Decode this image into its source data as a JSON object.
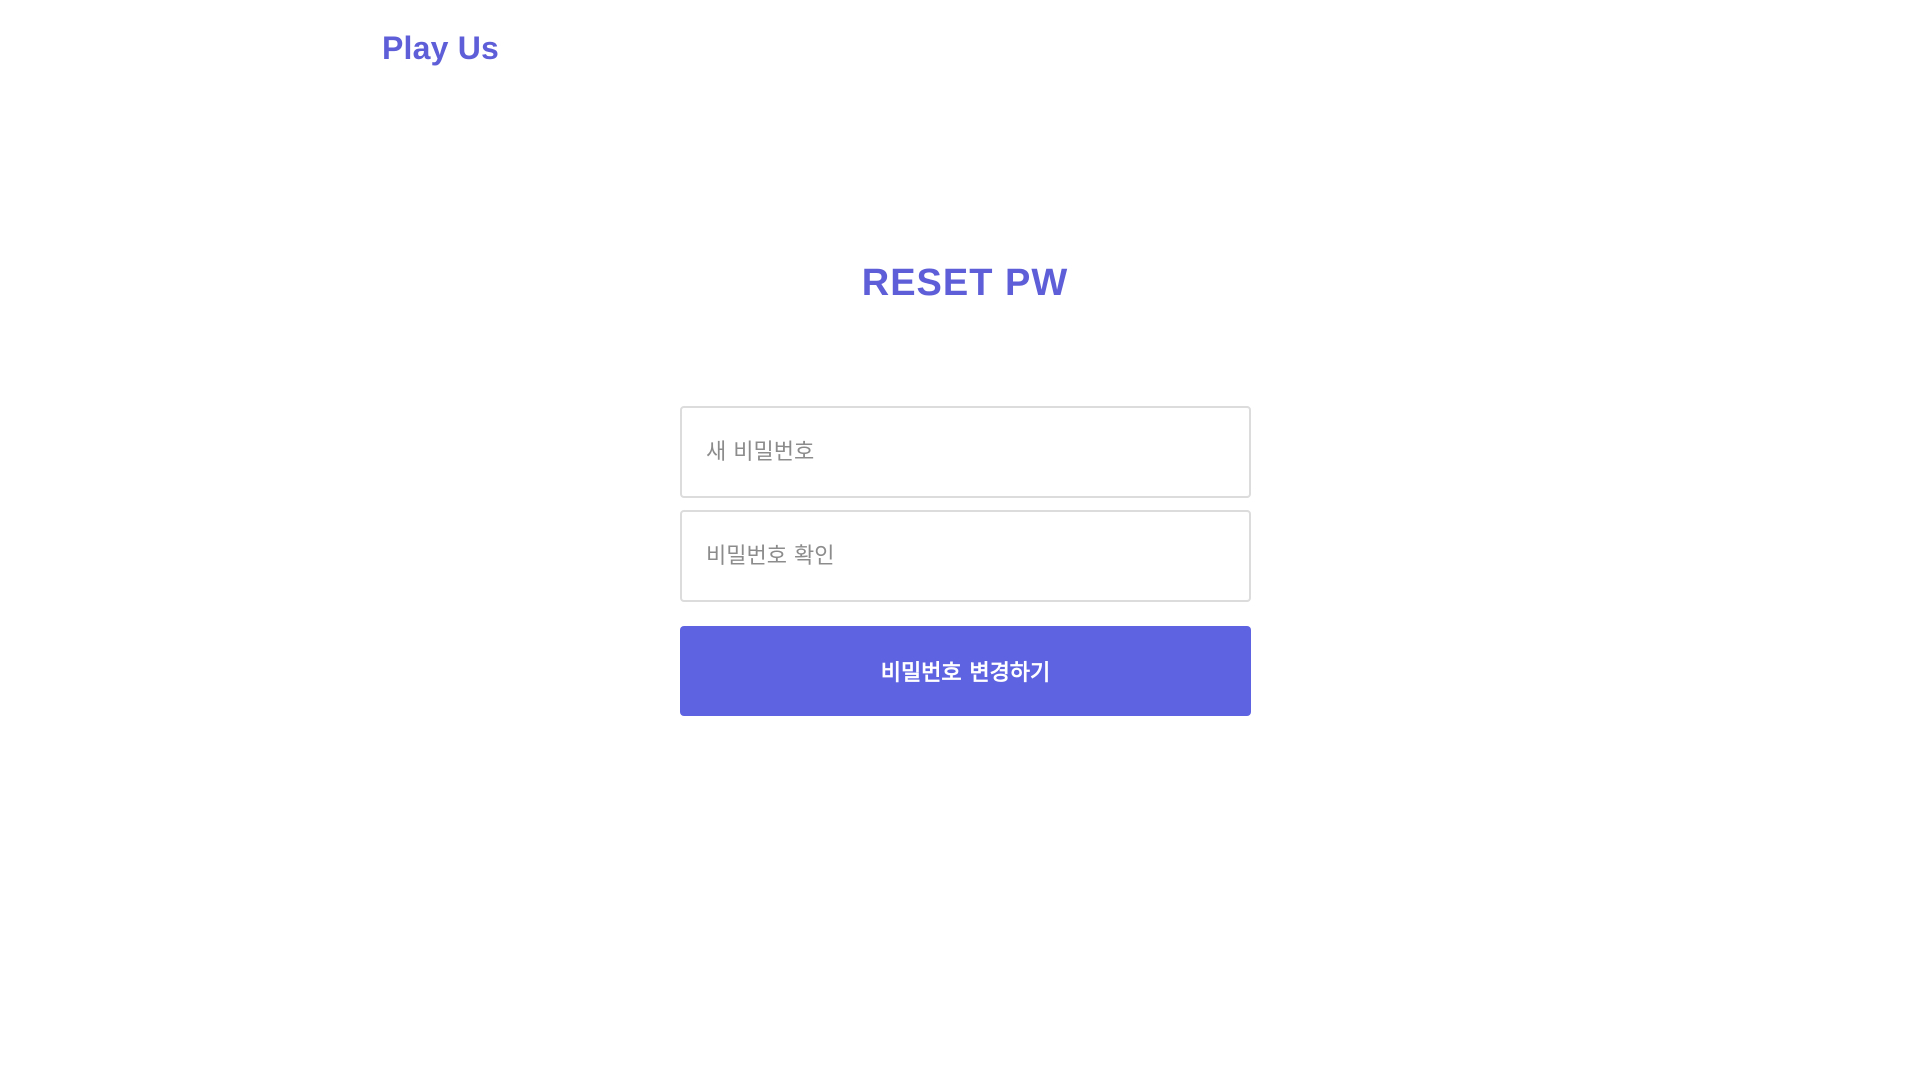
{
  "header": {
    "logo_text": "Play Us"
  },
  "main": {
    "title": "RESET PW",
    "new_password": {
      "value": "",
      "placeholder": "새 비밀번호"
    },
    "confirm_password": {
      "value": "",
      "placeholder": "비밀번호 확인"
    },
    "submit_label": "비밀번호 변경하기"
  },
  "colors": {
    "brand": "#5e5ed8",
    "button": "#5e63e2",
    "input_border": "#dcdcdc",
    "placeholder": "#8c8c8c"
  }
}
